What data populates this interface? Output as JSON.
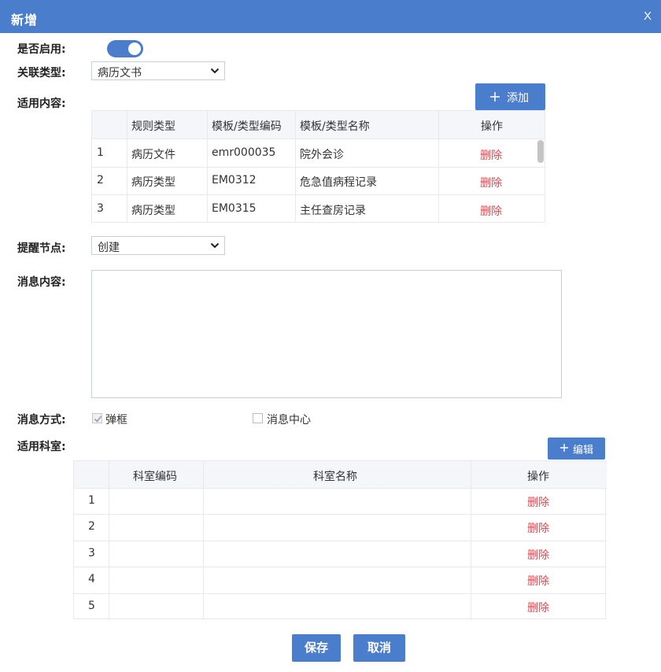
{
  "dialog": {
    "title": "新增",
    "close_label": "X"
  },
  "form": {
    "enabled_label": "是否启用:",
    "relation_type_label": "关联类型:",
    "relation_type_value": "病历文书",
    "content_label": "适用内容:",
    "add_button_label": "添加",
    "remind_node_label": "提醒节点:",
    "remind_node_value": "创建",
    "message_content_label": "消息内容:",
    "message_content_value": "",
    "message_method_label": "消息方式:",
    "method_popup_label": "弹框",
    "method_center_label": "消息中心",
    "dept_label": "适用科室:",
    "edit_button_label": "编辑"
  },
  "toggle": {
    "enabled": true
  },
  "checks": {
    "popup": true,
    "center": false
  },
  "content_table": {
    "headers": [
      "",
      "规则类型",
      "模板/类型编码",
      "模板/类型名称",
      "操作"
    ],
    "rows": [
      {
        "index": "1",
        "type": "病历文件",
        "code": "emr000035",
        "name": "院外会诊",
        "action": "删除"
      },
      {
        "index": "2",
        "type": "病历类型",
        "code": "EM0312",
        "name": "危急值病程记录",
        "action": "删除"
      },
      {
        "index": "3",
        "type": "病历类型",
        "code": "EM0315",
        "name": "主任查房记录",
        "action": "删除"
      }
    ]
  },
  "dept_table": {
    "headers": [
      "",
      "科室编码",
      "科室名称",
      "操作"
    ],
    "rows": [
      {
        "index": "1",
        "code": "",
        "name": "",
        "action": "删除"
      },
      {
        "index": "2",
        "code": "",
        "name": "",
        "action": "删除"
      },
      {
        "index": "3",
        "code": "",
        "name": "",
        "action": "删除"
      },
      {
        "index": "4",
        "code": "",
        "name": "",
        "action": "删除"
      },
      {
        "index": "5",
        "code": "",
        "name": "",
        "action": "删除"
      }
    ]
  },
  "footer": {
    "save_label": "保存",
    "cancel_label": "取消"
  },
  "colors": {
    "accent": "#4a7dcc",
    "delete": "#e8454f"
  },
  "icons": {
    "close": "close-icon",
    "chevron": "chevron-down-icon",
    "plus": "plus-icon",
    "check": "checkmark-icon"
  }
}
